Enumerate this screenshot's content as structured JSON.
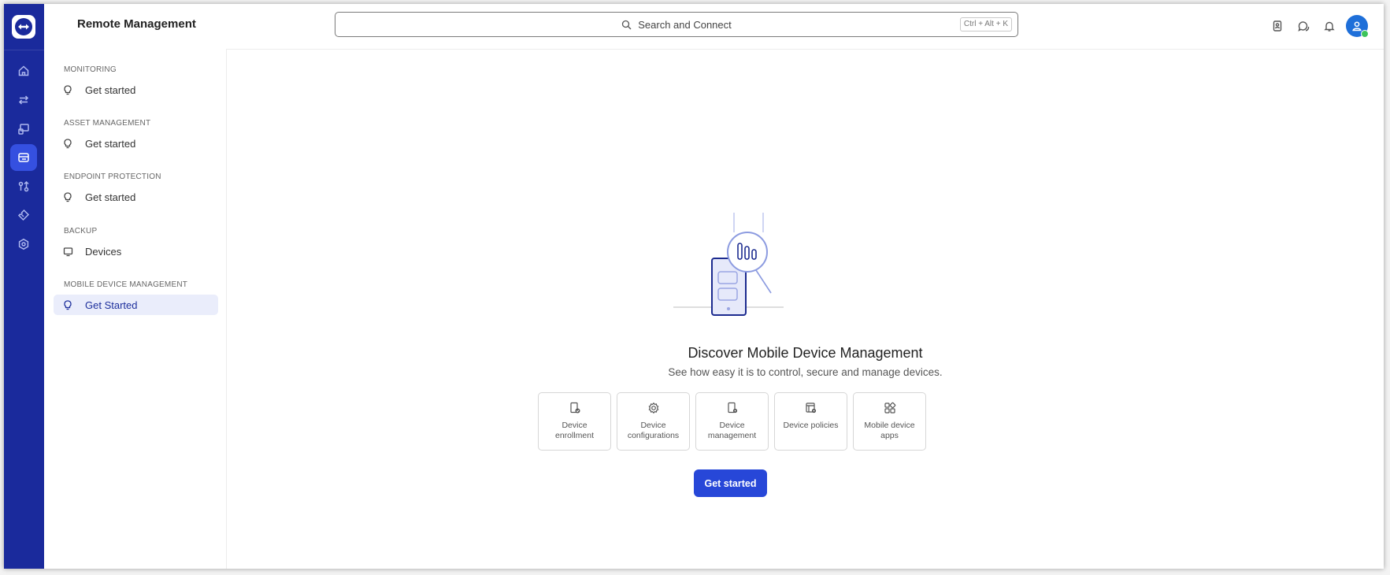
{
  "app": {
    "title": "Remote Management"
  },
  "search": {
    "placeholder": "Search and Connect",
    "shortcut": "Ctrl + Alt + K"
  },
  "rail": {
    "items": [
      {
        "icon": "home-icon"
      },
      {
        "icon": "swap-arrows-icon"
      },
      {
        "icon": "remote-screen-icon"
      },
      {
        "icon": "remote-management-icon",
        "active": true
      },
      {
        "icon": "integrations-icon"
      },
      {
        "icon": "ticket-icon"
      },
      {
        "icon": "settings-hex-icon"
      }
    ]
  },
  "topbar": {
    "icons": [
      "contacts-icon",
      "chat-icon",
      "bell-icon"
    ],
    "avatar_status": "online"
  },
  "sidebar": {
    "sections": [
      {
        "title": "MONITORING",
        "items": [
          {
            "label": "Get started",
            "icon": "lightbulb-icon"
          }
        ]
      },
      {
        "title": "ASSET MANAGEMENT",
        "items": [
          {
            "label": "Get started",
            "icon": "lightbulb-icon"
          }
        ]
      },
      {
        "title": "ENDPOINT PROTECTION",
        "items": [
          {
            "label": "Get started",
            "icon": "lightbulb-icon"
          }
        ]
      },
      {
        "title": "BACKUP",
        "items": [
          {
            "label": "Devices",
            "icon": "monitor-icon"
          }
        ]
      },
      {
        "title": "MOBILE DEVICE MANAGEMENT",
        "items": [
          {
            "label": "Get Started",
            "icon": "lightbulb-icon",
            "active": true
          }
        ]
      }
    ]
  },
  "main": {
    "heading": "Discover Mobile Device Management",
    "subheading": "See how easy it is to control, secure and manage devices.",
    "cards": [
      {
        "label": "Device enrollment",
        "icon": "device-check-icon"
      },
      {
        "label": "Device configurations",
        "icon": "gear-icon"
      },
      {
        "label": "Device management",
        "icon": "device-gear-icon"
      },
      {
        "label": "Device policies",
        "icon": "policy-icon"
      },
      {
        "label": "Mobile device apps",
        "icon": "apps-icon"
      }
    ],
    "cta_label": "Get started"
  },
  "colors": {
    "rail": "#1a2a9c",
    "accent": "#2747d8",
    "active_bg": "#eaedfb",
    "online": "#3cc35a"
  }
}
